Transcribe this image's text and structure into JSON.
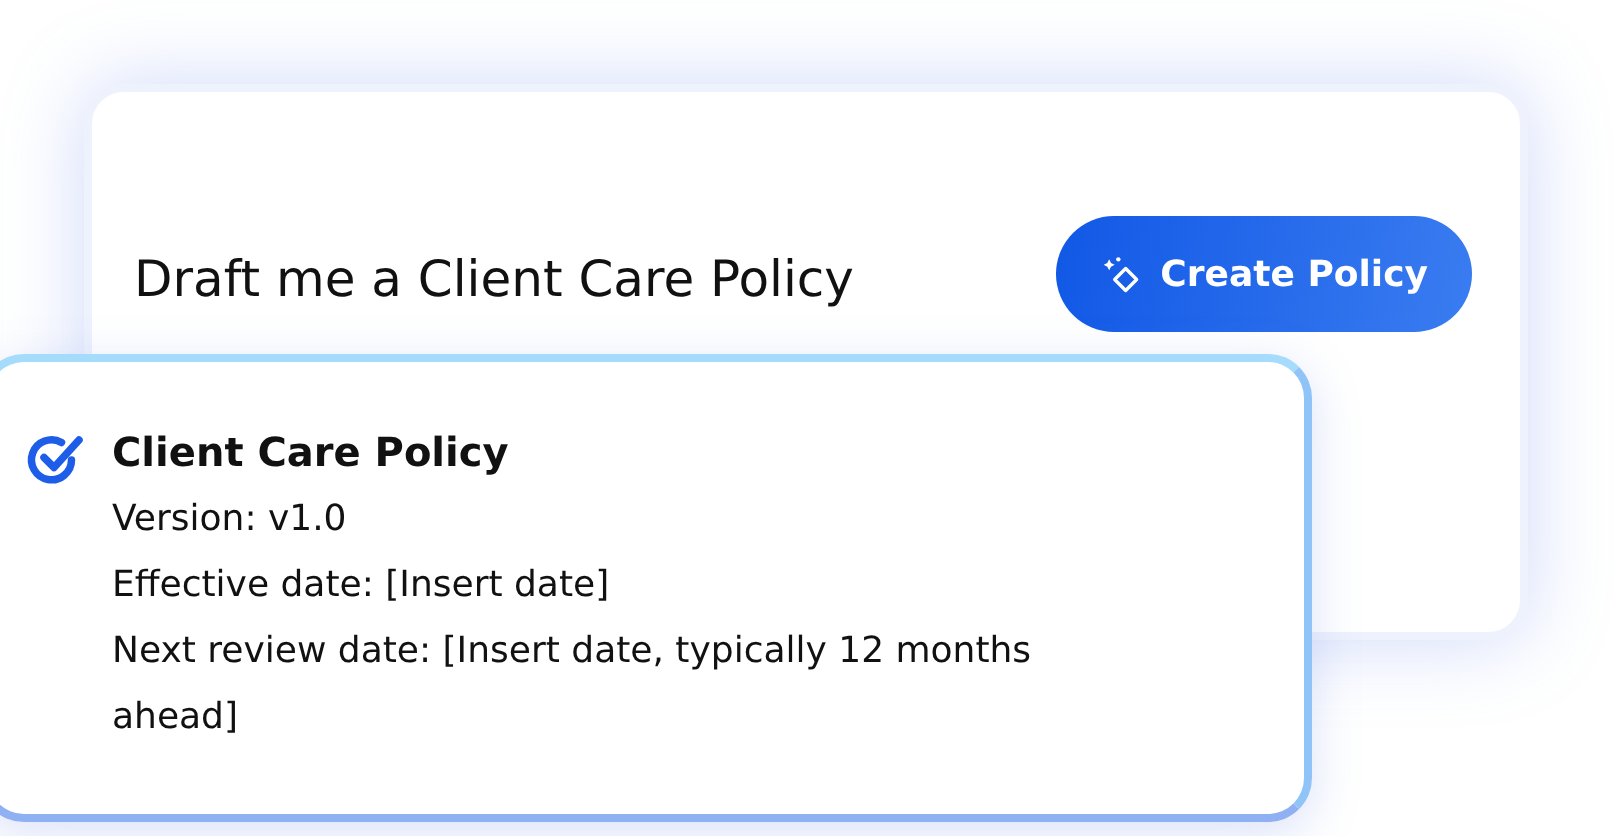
{
  "prompt": {
    "text": "Draft me a Client Care Policy",
    "button": "Create Policy"
  },
  "result": {
    "checked": true,
    "title": "Client Care Policy",
    "lines": [
      "Version: v1.0",
      "Effective date: [Insert date]",
      "Next review date: [Insert date, typically 12 months ahead]"
    ]
  }
}
